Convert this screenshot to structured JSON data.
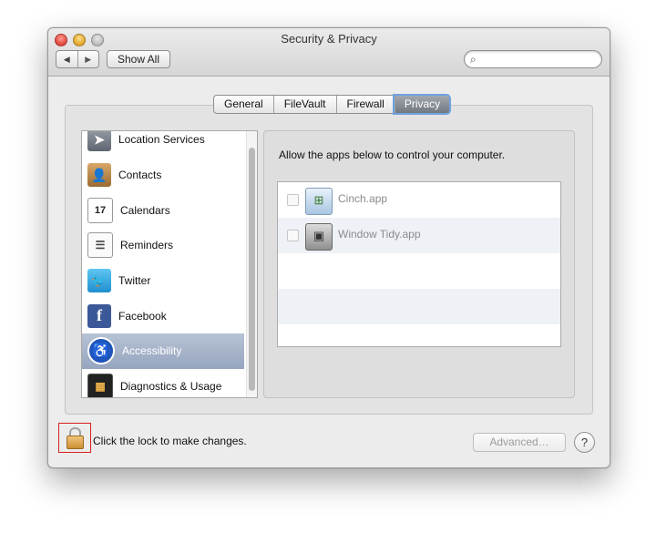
{
  "window": {
    "title": "Security & Privacy"
  },
  "toolbar": {
    "back_icon": "back-arrow-icon",
    "back_glyph": "◀",
    "forward_icon": "forward-arrow-icon",
    "forward_glyph": "▶",
    "show_all_label": "Show All",
    "search_placeholder": "",
    "search_icon_glyph": "⌕"
  },
  "tabs": [
    {
      "label": "General"
    },
    {
      "label": "FileVault"
    },
    {
      "label": "Firewall"
    },
    {
      "label": "Privacy",
      "active": true
    }
  ],
  "sidebar": {
    "items": [
      {
        "label": "Location Services",
        "icon": "location-arrow-icon",
        "glyph": "➤"
      },
      {
        "label": "Contacts",
        "icon": "contacts-book-icon",
        "glyph": "👤"
      },
      {
        "label": "Calendars",
        "icon": "calendar-icon",
        "glyph": "17"
      },
      {
        "label": "Reminders",
        "icon": "reminders-list-icon",
        "glyph": "☰"
      },
      {
        "label": "Twitter",
        "icon": "twitter-bird-icon",
        "glyph": "🐦"
      },
      {
        "label": "Facebook",
        "icon": "facebook-icon",
        "glyph": "f"
      },
      {
        "label": "Accessibility",
        "icon": "accessibility-icon",
        "glyph": "♿",
        "selected": true
      },
      {
        "label": "Diagnostics & Usage",
        "icon": "diagnostics-grid-icon",
        "glyph": "▦"
      }
    ]
  },
  "main": {
    "description": "Allow the apps below to control your computer.",
    "apps": [
      {
        "name": "Cinch.app",
        "icon": "cinch-app-icon",
        "glyph": "⊞",
        "checked": false
      },
      {
        "name": "Window Tidy.app",
        "icon": "window-tidy-app-icon",
        "glyph": "▣",
        "checked": false
      }
    ]
  },
  "footer": {
    "lock_text": "Click the lock to make changes.",
    "advanced_label": "Advanced…",
    "help_label": "?"
  },
  "colors": {
    "selection": "#96a5bf",
    "active_tab_focus": "#6fa2e0",
    "lock_highlight": "#d61f1f"
  }
}
